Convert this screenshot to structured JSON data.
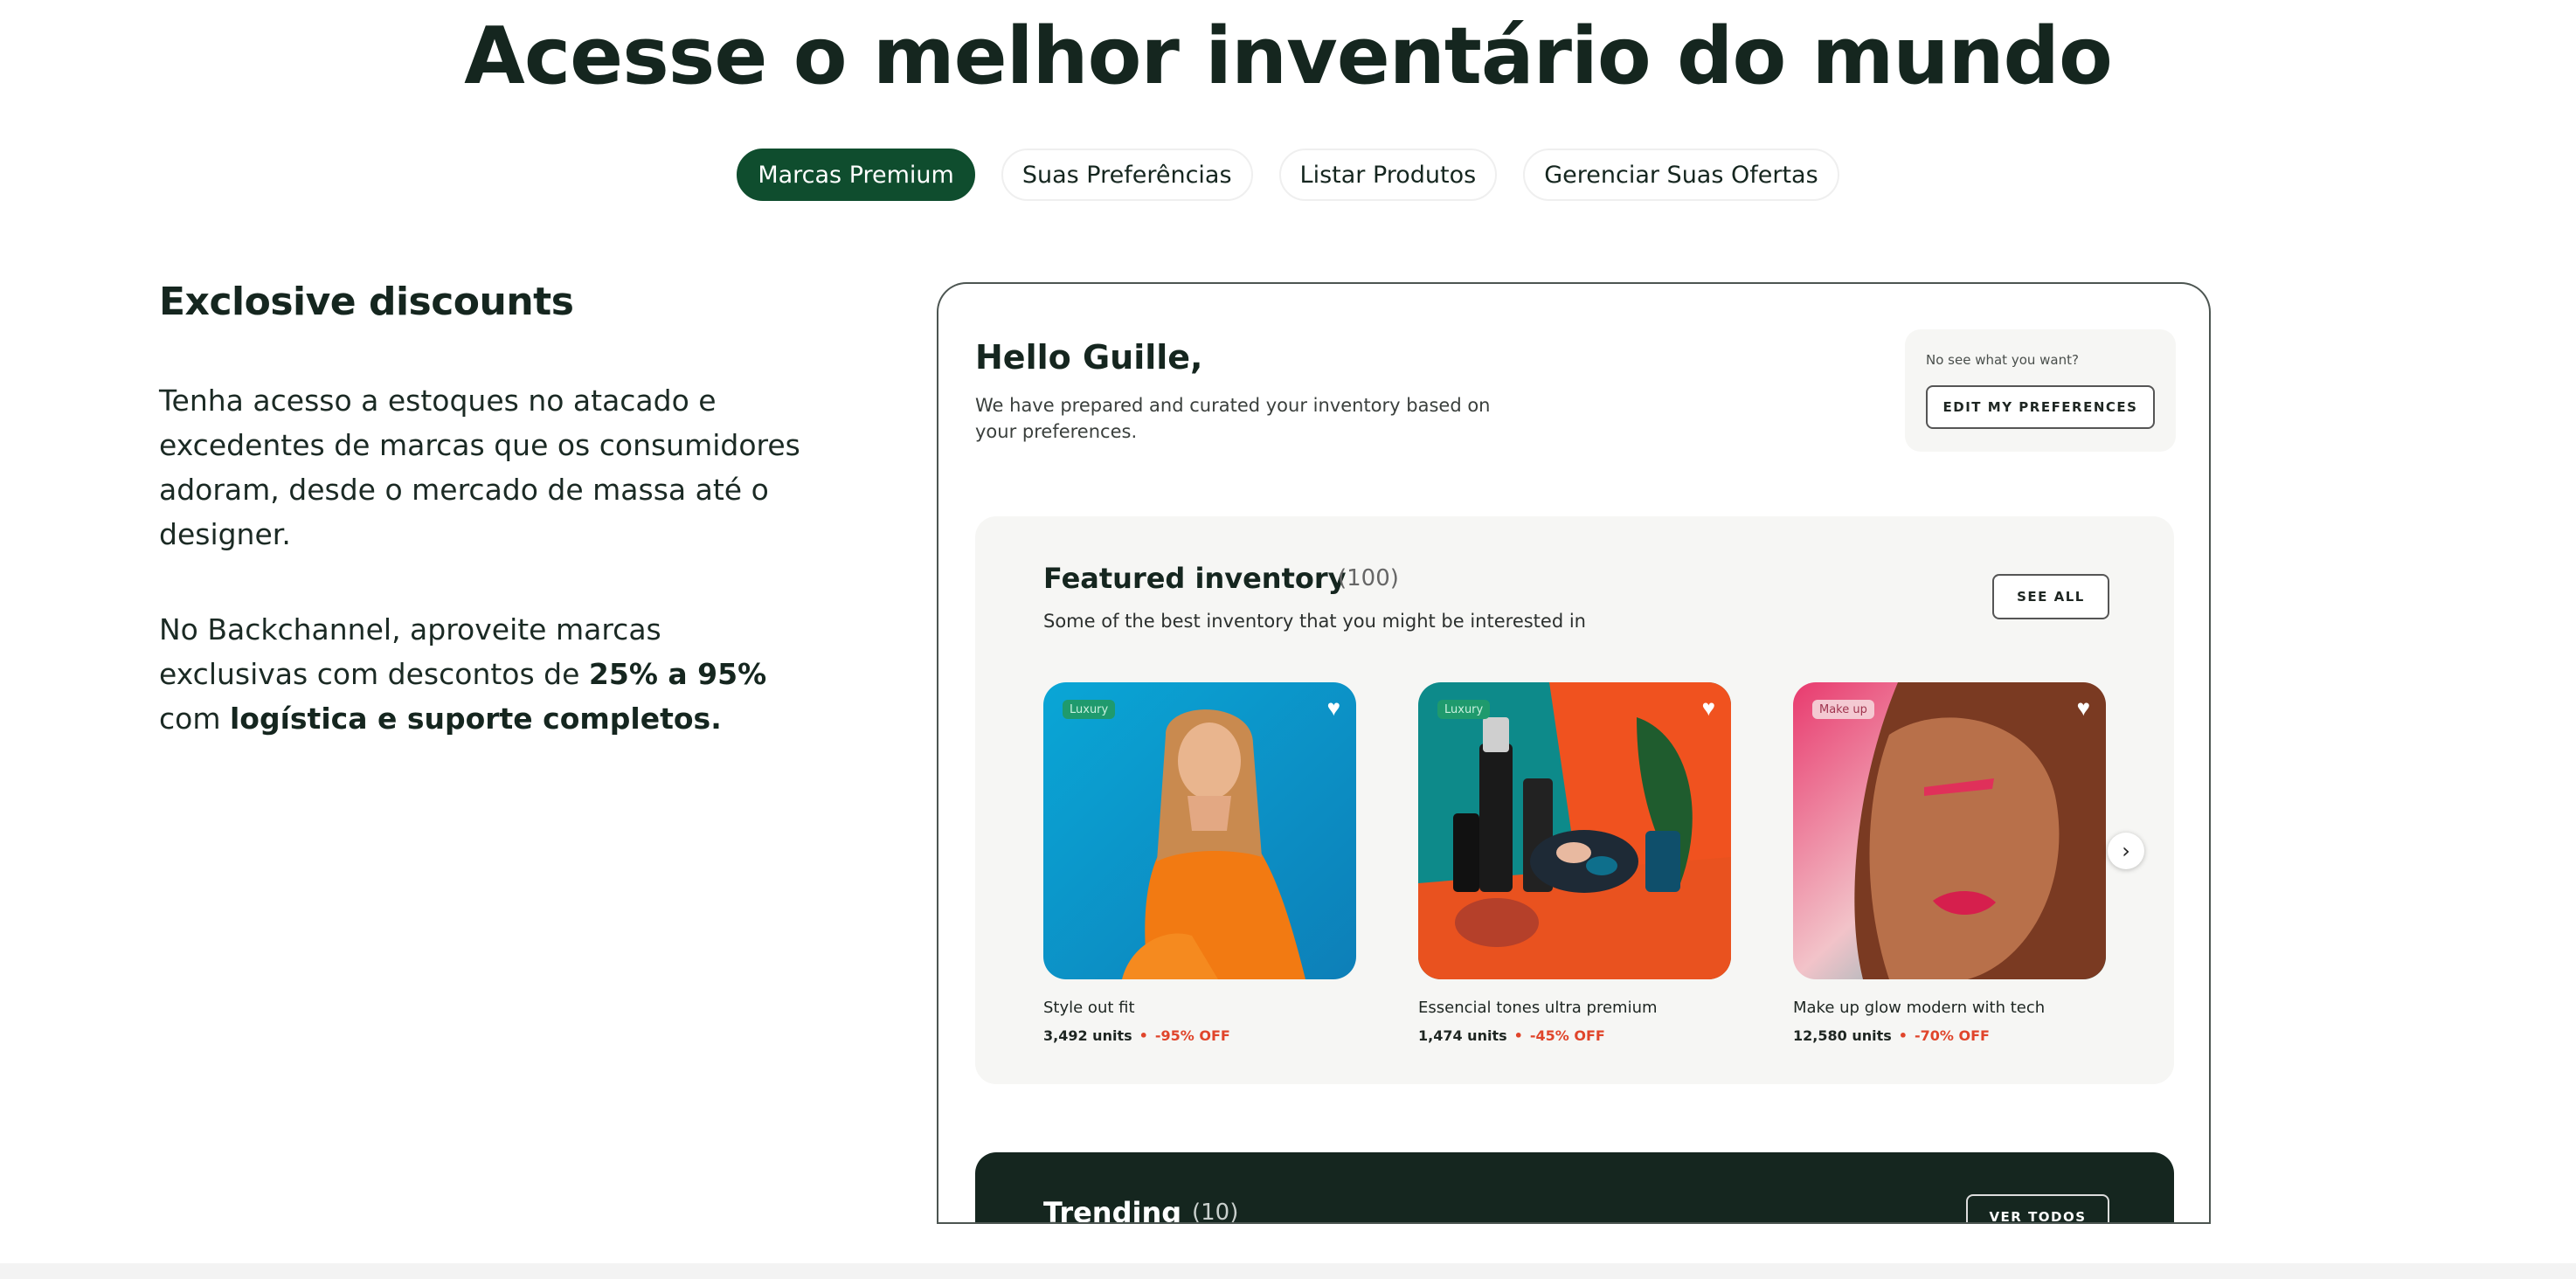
{
  "hero": {
    "title": "Acesse o melhor inventário do mundo"
  },
  "tabs": [
    {
      "label": "Marcas Premium",
      "active": true
    },
    {
      "label": "Suas Preferências",
      "active": false
    },
    {
      "label": "Listar Produtos",
      "active": false
    },
    {
      "label": "Gerenciar Suas Ofertas",
      "active": false
    }
  ],
  "left": {
    "title": "Exclosive discounts",
    "paragraph1": "Tenha acesso a estoques no atacado e excedentes de marcas que os consumidores adoram, desde o mercado de massa até o designer.",
    "paragraph2_prefix": "No Backchannel, aproveite marcas exclusivas com descontos de ",
    "paragraph2_bold1": "25% a 95%",
    "paragraph2_mid": " com ",
    "paragraph2_bold2": "logística e suporte completos."
  },
  "mock": {
    "greeting": "Hello Guille,",
    "greeting_sub": "We have prepared and curated your inventory based on your preferences.",
    "pref_label": "No see what you want?",
    "pref_button": "EDIT MY PREFERENCES",
    "featured": {
      "title": "Featured inventory",
      "count": "(100)",
      "subtitle": "Some of the best inventory that you might be interested in",
      "see_all": "SEE ALL",
      "cards": [
        {
          "tag": "Luxury",
          "name": "Style out fit",
          "units": "3,492 units",
          "dot": "•",
          "discount": "-95% OFF",
          "heart": "♥"
        },
        {
          "tag": "Luxury",
          "name": "Essencial tones ultra premium",
          "units": "1,474 units",
          "dot": "•",
          "discount": "-45% OFF",
          "heart": "♥"
        },
        {
          "tag": "Make up",
          "name": "Make up glow modern with tech",
          "units": "12,580 units",
          "dot": "•",
          "discount": "-70% OFF",
          "heart": "♥"
        }
      ],
      "next_icon": "›"
    },
    "trending": {
      "title": "Trending",
      "count": "(10)",
      "button": "VER TODOS"
    }
  },
  "colors": {
    "brand_green": "#0f4d2e",
    "dark": "#15261f",
    "discount": "#e0452b"
  }
}
